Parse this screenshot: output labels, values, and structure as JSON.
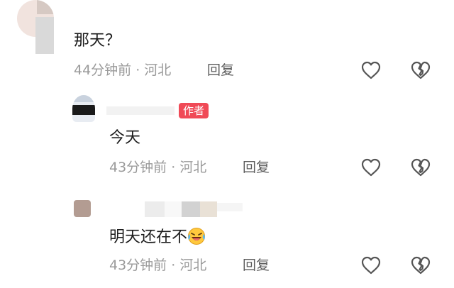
{
  "comments": [
    {
      "username": "",
      "text": "那天？",
      "time": "44分钟前",
      "location": "河北",
      "reply_label": "回复",
      "like_icon": "heart-outline-icon",
      "dislike_icon": "broken-heart-icon"
    },
    {
      "username": "",
      "badge": "作者",
      "text": "今天",
      "time": "43分钟前",
      "location": "河北",
      "reply_label": "回复",
      "like_icon": "heart-outline-icon",
      "dislike_icon": "broken-heart-icon"
    },
    {
      "username": "",
      "text": "明天还在不",
      "emoji": "laughing-tears-emoji",
      "time": "43分钟前",
      "location": "河北",
      "reply_label": "回复",
      "like_icon": "heart-outline-icon",
      "dislike_icon": "broken-heart-icon"
    }
  ],
  "separator": "·",
  "colors": {
    "badge_bg": "#f04a57",
    "text": "#1c1c1c",
    "meta": "#9a9a9a",
    "reply": "#5b5b5b",
    "icon": "#555555"
  }
}
